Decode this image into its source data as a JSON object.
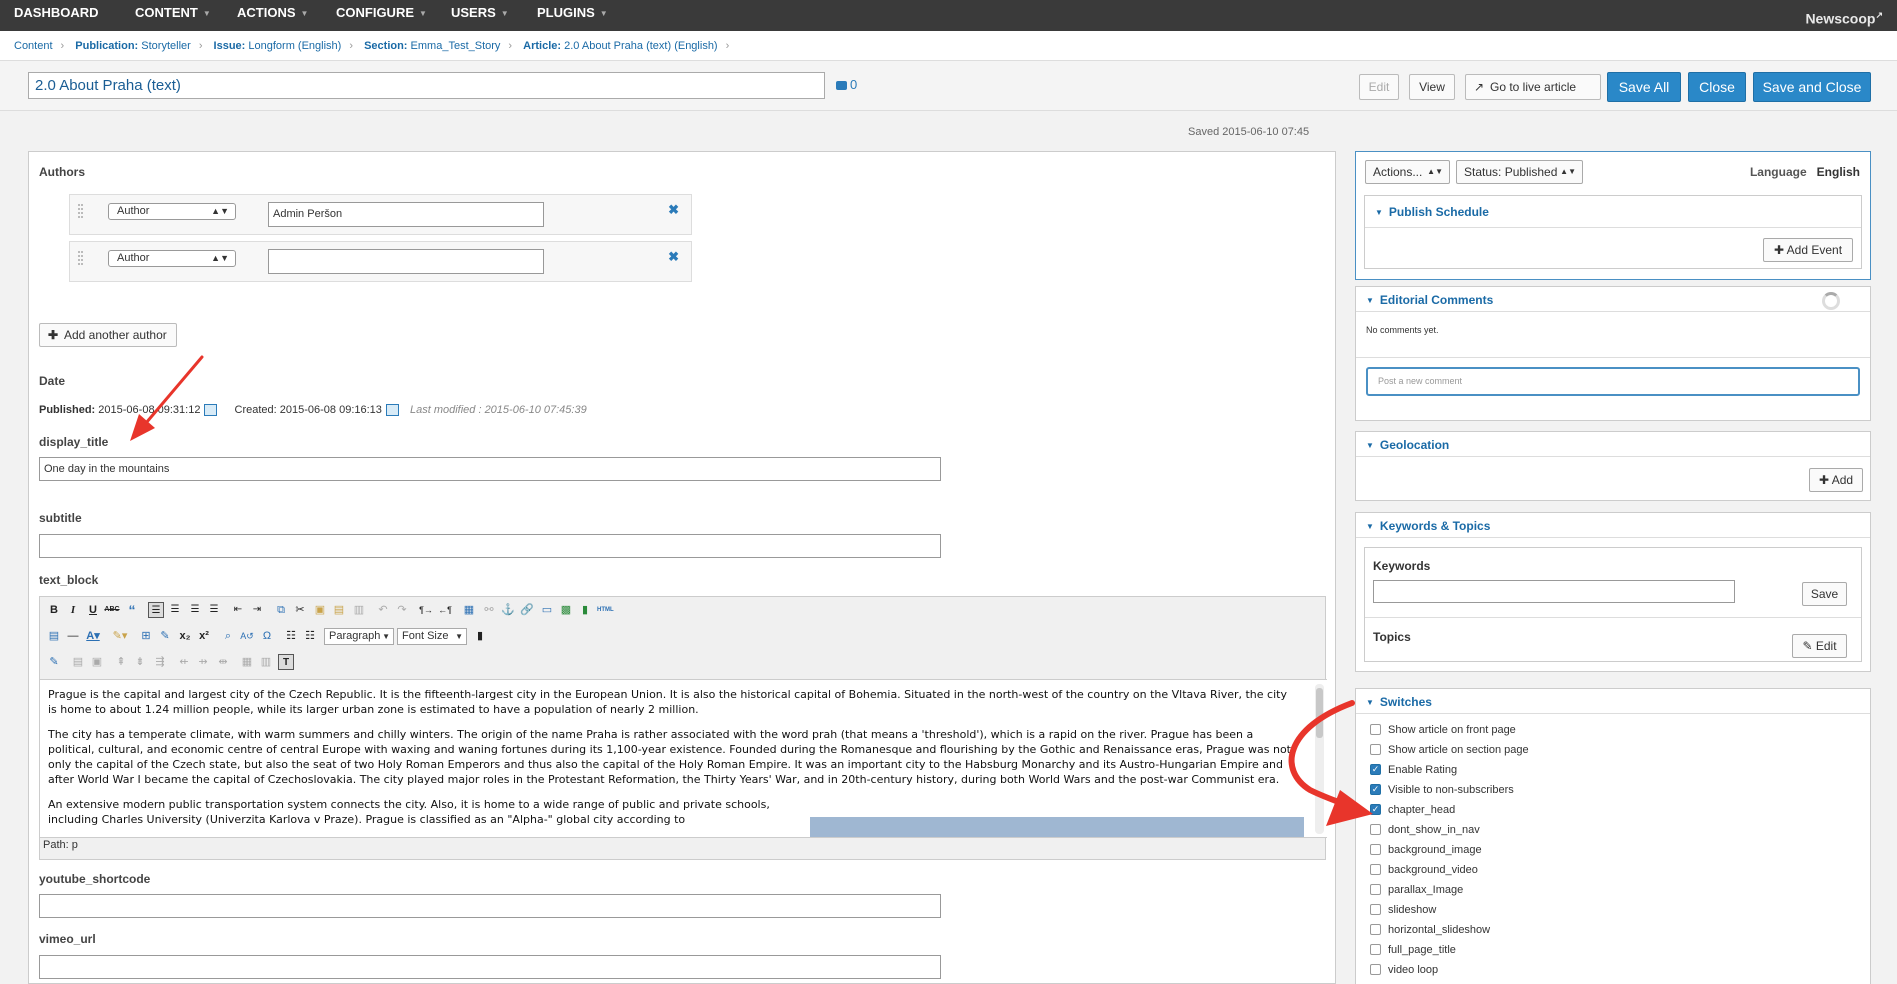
{
  "topnav": {
    "items": [
      "DASHBOARD",
      "CONTENT",
      "ACTIONS",
      "CONFIGURE",
      "USERS",
      "PLUGINS"
    ],
    "brand": "Newscoop"
  },
  "breadcrumb": {
    "content": "Content",
    "publication_label": "Publication:",
    "publication": "Storyteller",
    "issue_label": "Issue:",
    "issue": "Longform (English)",
    "section_label": "Section:",
    "section": "Emma_Test_Story",
    "article_label": "Article:",
    "article": "2.0 About Praha (text) (English)"
  },
  "header": {
    "title": "2.0 About Praha (text)",
    "comment_count": "0",
    "edit": "Edit",
    "view": "View",
    "live": "Go to live article",
    "save_all": "Save All",
    "close": "Close",
    "save_close": "Save and Close",
    "saved": "Saved 2015-06-10 07:45"
  },
  "authors": {
    "label": "Authors",
    "rows": [
      {
        "role": "Author",
        "name": "Admin Peršon"
      },
      {
        "role": "Author",
        "name": ""
      }
    ],
    "add": "Add another author"
  },
  "date": {
    "label": "Date",
    "published_label": "Published:",
    "published": "2015-06-08 09:31:12",
    "created": "Created: 2015-06-08 09:16:13",
    "modified": "Last modified : 2015-06-10 07:45:39"
  },
  "fields": {
    "display_title_label": "display_title",
    "display_title": "One day in the mountains",
    "subtitle_label": "subtitle",
    "subtitle": "",
    "text_block_label": "text_block",
    "youtube_label": "youtube_shortcode",
    "youtube": "",
    "vimeo_label": "vimeo_url",
    "vimeo": ""
  },
  "editor": {
    "format": "Paragraph",
    "font_size": "Font Size",
    "paragraphs": [
      "Prague is the capital and largest city of the Czech Republic. It is the fifteenth-largest city in the European Union. It is also the historical capital of Bohemia. Situated in the north-west of the country on the Vltava River, the city is home to about 1.24 million people, while its larger urban zone is estimated to have a population of nearly 2 million.",
      "The city has a temperate climate, with warm summers and chilly winters. The origin of the name Praha is rather associated with the word prah (that means a 'threshold'), which is a rapid on the river. Prague has been a political, cultural, and economic centre of central Europe with waxing and waning fortunes during its 1,100-year existence. Founded during the Romanesque and flourishing by the Gothic and Renaissance eras, Prague was not only the capital of the Czech state, but also the seat of two Holy Roman Emperors and thus also the capital of the Holy Roman Empire. It was an important city to the Habsburg Monarchy and its Austro-Hungarian Empire and after World War I became the capital of Czechoslovakia. The city played major roles in the Protestant Reformation, the Thirty Years' War, and in 20th-century history, during both World Wars and the post-war Communist era.",
      "An extensive modern public transportation system connects the city. Also, it is home to a wide range of public and private schools, including Charles University (Univerzita Karlova v Praze). Prague is classified as an \"Alpha-\" global city according to"
    ],
    "path": "Path: p"
  },
  "side": {
    "actions": "Actions...",
    "status": "Status: Published",
    "language_label": "Language",
    "language": "English",
    "publish_schedule": "Publish Schedule",
    "add_event": "Add Event",
    "editorial_comments": "Editorial Comments",
    "no_comments": "No comments yet.",
    "comment_placeholder": "Post a new comment",
    "geolocation": "Geolocation",
    "geo_add": "Add",
    "keywords_topics": "Keywords & Topics",
    "keywords": "Keywords",
    "keywords_value": "",
    "save": "Save",
    "topics": "Topics",
    "topics_edit": "Edit",
    "switches": "Switches",
    "switch_items": [
      {
        "label": "Show article on front page",
        "checked": false
      },
      {
        "label": "Show article on section page",
        "checked": false
      },
      {
        "label": "Enable Rating",
        "checked": true
      },
      {
        "label": "Visible to non-subscribers",
        "checked": true
      },
      {
        "label": "chapter_head",
        "checked": true
      },
      {
        "label": "dont_show_in_nav",
        "checked": false
      },
      {
        "label": "background_image",
        "checked": false
      },
      {
        "label": "background_video",
        "checked": false
      },
      {
        "label": "parallax_Image",
        "checked": false
      },
      {
        "label": "slideshow",
        "checked": false
      },
      {
        "label": "horizontal_slideshow",
        "checked": false
      },
      {
        "label": "full_page_title",
        "checked": false
      },
      {
        "label": "video loop",
        "checked": false
      }
    ]
  },
  "colors": {
    "accent": "#2a88c8",
    "annotation_arrow": "#e8352b",
    "nav_bg": "#3a3a3a"
  }
}
